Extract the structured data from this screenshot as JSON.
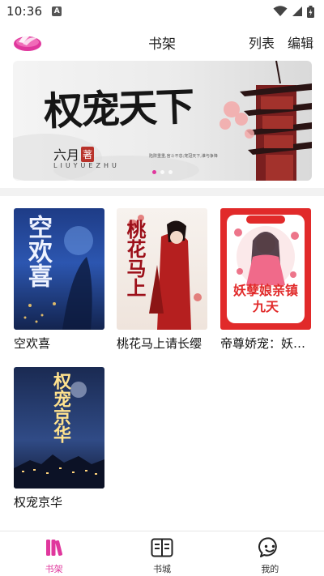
{
  "status_bar": {
    "time": "10:36",
    "notification_icon": "a-notification-icon",
    "icons": [
      "wifi-icon",
      "signal-icon",
      "battery-icon"
    ]
  },
  "header": {
    "title": "书架",
    "list_label": "列表",
    "edit_label": "编辑",
    "logo_icon": "app-logo-icon"
  },
  "banner": {
    "title": "权宠天下",
    "author": "六月",
    "author_suffix": "著",
    "pinyin": "LIUYUEZHU",
    "caption": "陷阱重重,宫斗不息;宠冠天下,谁与争锋",
    "page_count": 3,
    "active_page": 0
  },
  "shelf": {
    "books": [
      {
        "title": "空欢喜",
        "cover_text": "空欢喜",
        "cover_style": "night-blue"
      },
      {
        "title": "桃花马上请长缨",
        "cover_text": "桃花马上",
        "cover_style": "red-warrior"
      },
      {
        "title": "帝尊娇宠：妖孽娘亲镇九天",
        "cover_text": "妖孽娘亲镇九天",
        "cover_style": "red-frame"
      },
      {
        "title": "权宠京华",
        "cover_text": "权宠京华",
        "cover_style": "night-city"
      }
    ]
  },
  "bottom_nav": {
    "items": [
      {
        "label": "书架",
        "icon": "bookshelf-icon",
        "active": true
      },
      {
        "label": "书城",
        "icon": "book-store-icon",
        "active": false
      },
      {
        "label": "我的",
        "icon": "profile-chat-icon",
        "active": false
      }
    ]
  },
  "colors": {
    "accent": "#e0379d",
    "text": "#222222",
    "divider": "#f2f2f2"
  }
}
